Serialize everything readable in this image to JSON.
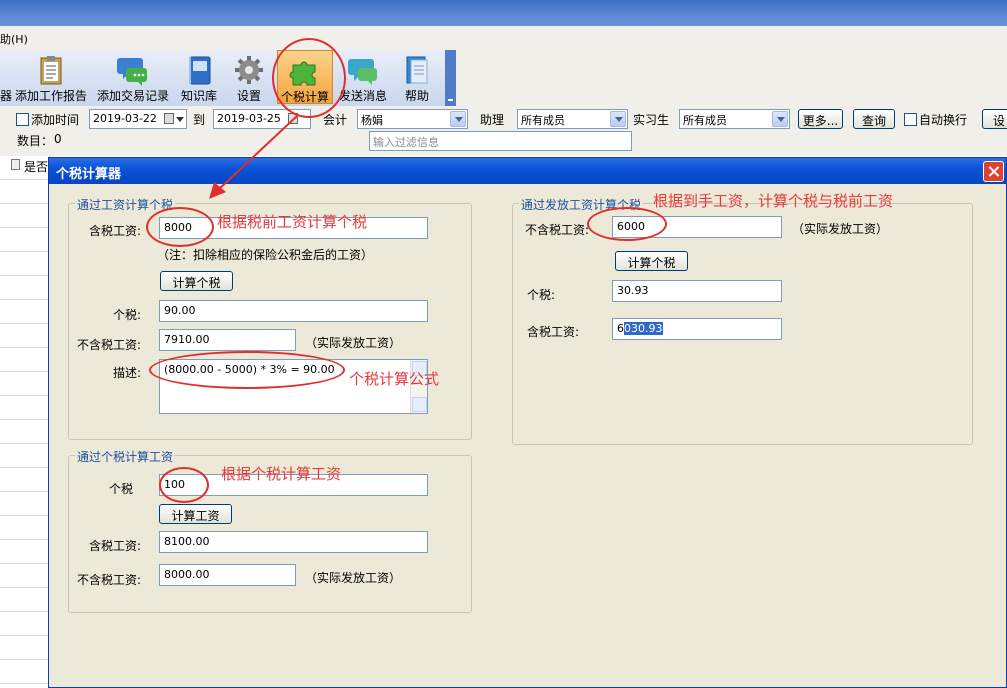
{
  "menu": {
    "help_fragment": "助(H)"
  },
  "toolbar": {
    "items": [
      {
        "label": "添加工作报告",
        "icon": "clipboard-icon"
      },
      {
        "label": "添加交易记录",
        "icon": "chat-bubbles-icon"
      },
      {
        "label": "知识库",
        "icon": "book-icon"
      },
      {
        "label": "设置",
        "icon": "gear-icon"
      },
      {
        "label": "个税计算",
        "icon": "puzzle-icon",
        "active": true
      },
      {
        "label": "发送消息",
        "icon": "message-icon"
      },
      {
        "label": "帮助",
        "icon": "help-book-icon"
      }
    ],
    "left_fragment": "器"
  },
  "filters": {
    "add_time_label": "添加时间",
    "date_from": "2019-03-22",
    "to_label": "到",
    "date_to": "2019-03-25",
    "accountant_label": "会计",
    "accountant_value": "杨娟",
    "assistant_label": "助理",
    "assistant_value": "所有成员",
    "intern_label": "实习生",
    "intern_value": "所有成员",
    "more_button": "更多...",
    "query_button": "查询",
    "auto_wrap_label": "自动换行",
    "settings_fragment": "设",
    "count_label": "数目：",
    "count_value": "0",
    "filter_placeholder": "输入过滤信息",
    "grid_header_fragment": "是否"
  },
  "dialog": {
    "title": "个税计算器",
    "group1": {
      "title": "通过工资计算个税",
      "gross_label": "含税工资:",
      "gross_value": "8000",
      "note": "（注：扣除相应的保险公积金后的工资）",
      "calc_button": "计算个税",
      "tax_label": "个税:",
      "tax_value": "90.00",
      "net_label": "不含税工资:",
      "net_value": "7910.00",
      "net_note": "（实际发放工资）",
      "desc_label": "描述:",
      "desc_value": "(8000.00 - 5000) * 3% = 90.00"
    },
    "group2": {
      "title": "通过个税计算工资",
      "tax_label": "个税",
      "tax_value": "100",
      "calc_button": "计算工资",
      "gross_label": "含税工资:",
      "gross_value": "8100.00",
      "net_label": "不含税工资:",
      "net_value": "8000.00",
      "net_note": "（实际发放工资）"
    },
    "group3": {
      "title": "通过发放工资计算个税",
      "net_label": "不含税工资:",
      "net_value": "6000",
      "net_note": "（实际发放工资）",
      "calc_button": "计算个税",
      "tax_label": "个税:",
      "tax_value": "30.93",
      "gross_label": "含税工资:",
      "gross_value_prefix": "6",
      "gross_value_selected": "030.93"
    }
  },
  "annotations": {
    "a1": "根据税前工资计算个税",
    "a2": "个税计算公式",
    "a3": "根据个税计算工资",
    "a4": "根据到手工资，计算个税与税前工资",
    "color": "#e8393b"
  }
}
